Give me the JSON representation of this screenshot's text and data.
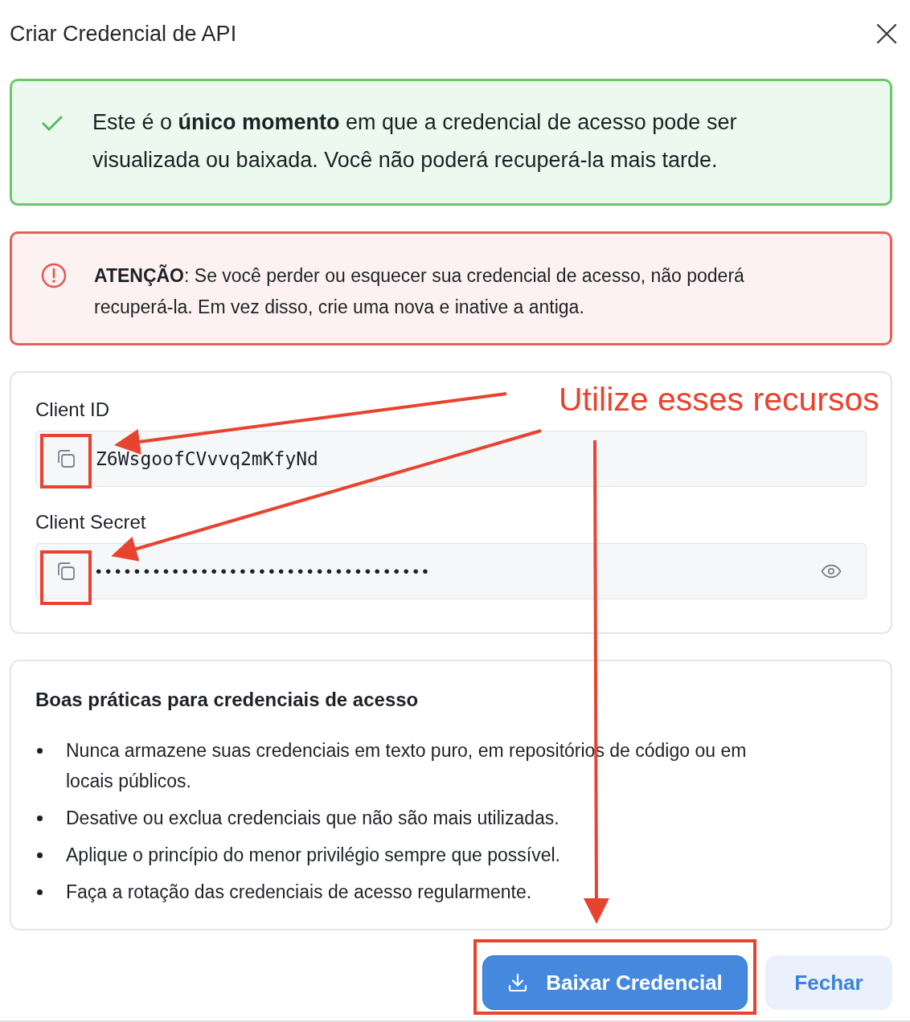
{
  "dialog": {
    "title": "Criar Credencial de API"
  },
  "success_notice": {
    "text": "Este é o **único momento** em que a credencial de acesso pode ser visualizada ou baixada. Você não poderá recuperá-la mais tarde."
  },
  "warning_notice": {
    "text": "**ATENÇÃO**: Se você perder ou esquecer sua credencial de acesso, não poderá recuperá-la. Em vez disso, crie uma nova e inative a antiga."
  },
  "fields": [
    {
      "label": "Client ID",
      "value": "Z6WsgoofCVvvq2mKfyNd",
      "masked": false
    },
    {
      "label": "Client Secret",
      "value": "•••••••••••••••••••••••••••••••••••",
      "masked": true
    }
  ],
  "best_practices": {
    "title": "Boas práticas para credenciais de acesso",
    "items": [
      "Nunca armazene suas credenciais em texto puro, em repositórios de código ou em locais públicos.",
      "Desative ou exclua credenciais que não são mais utilizadas.",
      "Aplique o princípio do menor privilégio sempre que possível.",
      "Faça a rotação das credenciais de acesso regularmente."
    ]
  },
  "buttons": [
    {
      "label": "Baixar Credencial",
      "kind": "primary"
    },
    {
      "label": "Fechar",
      "kind": "secondary"
    }
  ],
  "annotation": {
    "text": "Utilize esses recursos"
  }
}
